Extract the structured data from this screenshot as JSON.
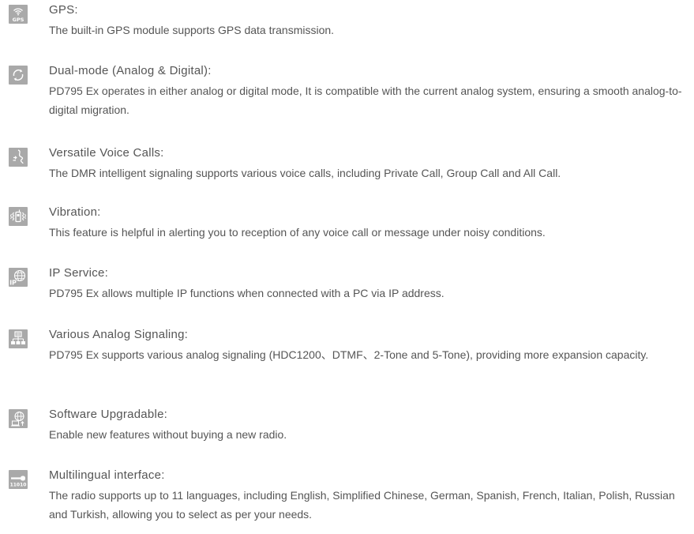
{
  "features": [
    {
      "icon": "gps-icon",
      "title": "GPS:",
      "description": "The built-in GPS module supports GPS data transmission."
    },
    {
      "icon": "dual-mode-icon",
      "title": "Dual-mode (Analog & Digital):",
      "description": "PD795 Ex operates in either analog or digital mode,  It is compatible with the current analog system, ensuring a smooth analog-to-digital migration."
    },
    {
      "icon": "voice-call-icon",
      "title": "Versatile Voice Calls:",
      "description": "The DMR intelligent signaling supports various voice calls, including Private Call, Group Call and All Call."
    },
    {
      "icon": "vibration-icon",
      "title": "Vibration:",
      "description": "This feature is helpful in alerting you to reception of any voice call or message under noisy conditions."
    },
    {
      "icon": "ip-service-icon",
      "title": "IP Service:",
      "description": "PD795 Ex allows multiple IP functions when connected with a PC via IP address."
    },
    {
      "icon": "analog-signaling-icon",
      "title": "Various Analog Signaling:",
      "description": "PD795 Ex supports various analog signaling (HDC1200、DTMF、2-Tone and 5-Tone), providing more expansion capacity."
    },
    {
      "icon": "software-upgrade-icon",
      "title": "Software Upgradable:",
      "description": "Enable new features without buying a new radio."
    },
    {
      "icon": "multilingual-icon",
      "title": "Multilingual interface:",
      "description": "The radio supports up to 11 languages, including English, Simplified Chinese, German, Spanish, French, Italian, Polish, Russian and Turkish,  allowing you to select as per your needs."
    }
  ]
}
